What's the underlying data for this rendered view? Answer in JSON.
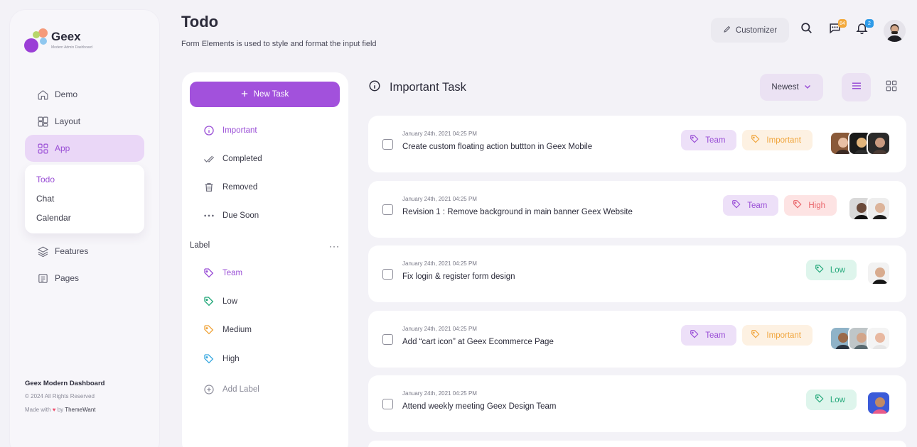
{
  "brand": {
    "name": "Geex",
    "tagline": "Modern Admin Dashboard"
  },
  "nav": {
    "items": [
      {
        "label": "Demo",
        "icon": "home-icon"
      },
      {
        "label": "Layout",
        "icon": "layout-icon"
      },
      {
        "label": "App",
        "icon": "apps-grid-icon",
        "active": true
      }
    ],
    "submenu": [
      "Todo",
      "Chat",
      "Calendar"
    ],
    "items_after": [
      {
        "label": "Features",
        "icon": "layers-icon"
      },
      {
        "label": "Pages",
        "icon": "document-icon"
      }
    ]
  },
  "sidebar_footer": {
    "title": "Geex Modern Dashboard",
    "copyright": "© 2024 All Rights Reserved",
    "made_with": "Made with",
    "heart": "♥",
    "by": "by",
    "author": "ThemeWant"
  },
  "header": {
    "title": "Todo",
    "subtitle": "Form Elements is used to style and format the input field",
    "customizer_label": "Customizer",
    "messages_badge": "84",
    "notifications_badge": "2"
  },
  "filters": {
    "new_task_label": "New Task",
    "items": [
      "Important",
      "Completed",
      "Removed",
      "Due Soon"
    ],
    "label_heading": "Label",
    "labels": [
      "Team",
      "Low",
      "Medium",
      "High"
    ],
    "add_label": "Add Label"
  },
  "list": {
    "title": "Important Task",
    "sort_label": "Newest",
    "tasks": [
      {
        "date": "January 24th, 2021 04:25 PM",
        "title": "Create custom floating action buttton in Geex Mobile",
        "tags": [
          "Team",
          "Important"
        ]
      },
      {
        "date": "January 24th, 2021 04:25 PM",
        "title": "Revision 1 : Remove background in main banner Geex Website",
        "tags": [
          "Team",
          "High"
        ]
      },
      {
        "date": "January 24th, 2021 04:25 PM",
        "title": "Fix login & register form design",
        "tags": [
          "Low"
        ]
      },
      {
        "date": "January 24th, 2021 04:25 PM",
        "title": "Add “cart icon” at Geex Ecommerce Page",
        "tags": [
          "Team",
          "Important"
        ]
      },
      {
        "date": "January 24th, 2021 04:25 PM",
        "title": "Attend weekly meeting Geex Design Team",
        "tags": [
          "Low"
        ]
      }
    ]
  },
  "colors": {
    "accent": "#a251dc",
    "team": "#9a4fd6",
    "important": "#f0a53c",
    "high": "#e9646a",
    "low": "#23a87a",
    "medium": "#f0a53c",
    "label_high": "#3aa9e0"
  }
}
